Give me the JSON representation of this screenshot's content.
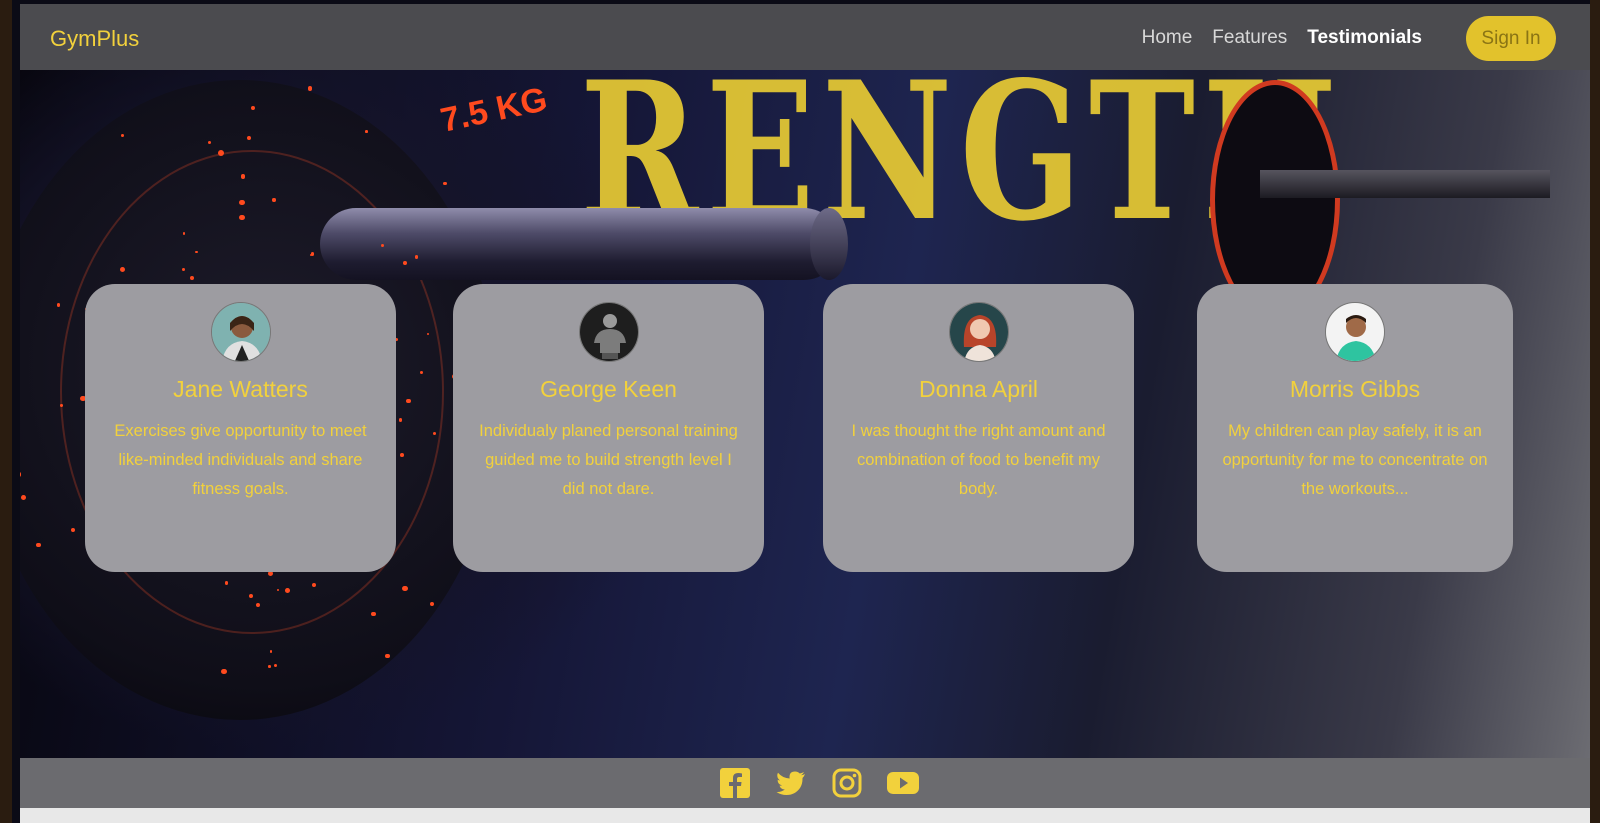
{
  "navbar": {
    "brand": "GymPlus",
    "links": [
      {
        "label": "Home",
        "active": false
      },
      {
        "label": "Features",
        "active": false
      },
      {
        "label": "Testimonials",
        "active": true
      }
    ],
    "sign_in": "Sign In"
  },
  "hero": {
    "wall_text": "RENGTH",
    "plate_label": "7.5 KG"
  },
  "testimonials": [
    {
      "name": "Jane Watters",
      "quote": "Exercises give opportunity to meet like-minded individuals and share fitness goals.",
      "avatar_icon": "avatar-photo"
    },
    {
      "name": "George Keen",
      "quote": "Individualy planed personal training guided me to build strength level I did not dare.",
      "avatar_icon": "avatar-photo"
    },
    {
      "name": "Donna April",
      "quote": "I was thought the right amount and combination of food to benefit my body.",
      "avatar_icon": "avatar-photo"
    },
    {
      "name": "Morris Gibbs",
      "quote": "My children can play safely, it is an opportunity for me to concentrate on the workouts...",
      "avatar_icon": "avatar-photo"
    }
  ],
  "footer": {
    "socials": [
      "facebook-icon",
      "twitter-icon",
      "instagram-icon",
      "youtube-icon"
    ]
  },
  "colors": {
    "accent": "#f2d13c",
    "navbar": "#4b4b4f",
    "card": "#9d9ca1",
    "footer": "#6b6b6f"
  }
}
